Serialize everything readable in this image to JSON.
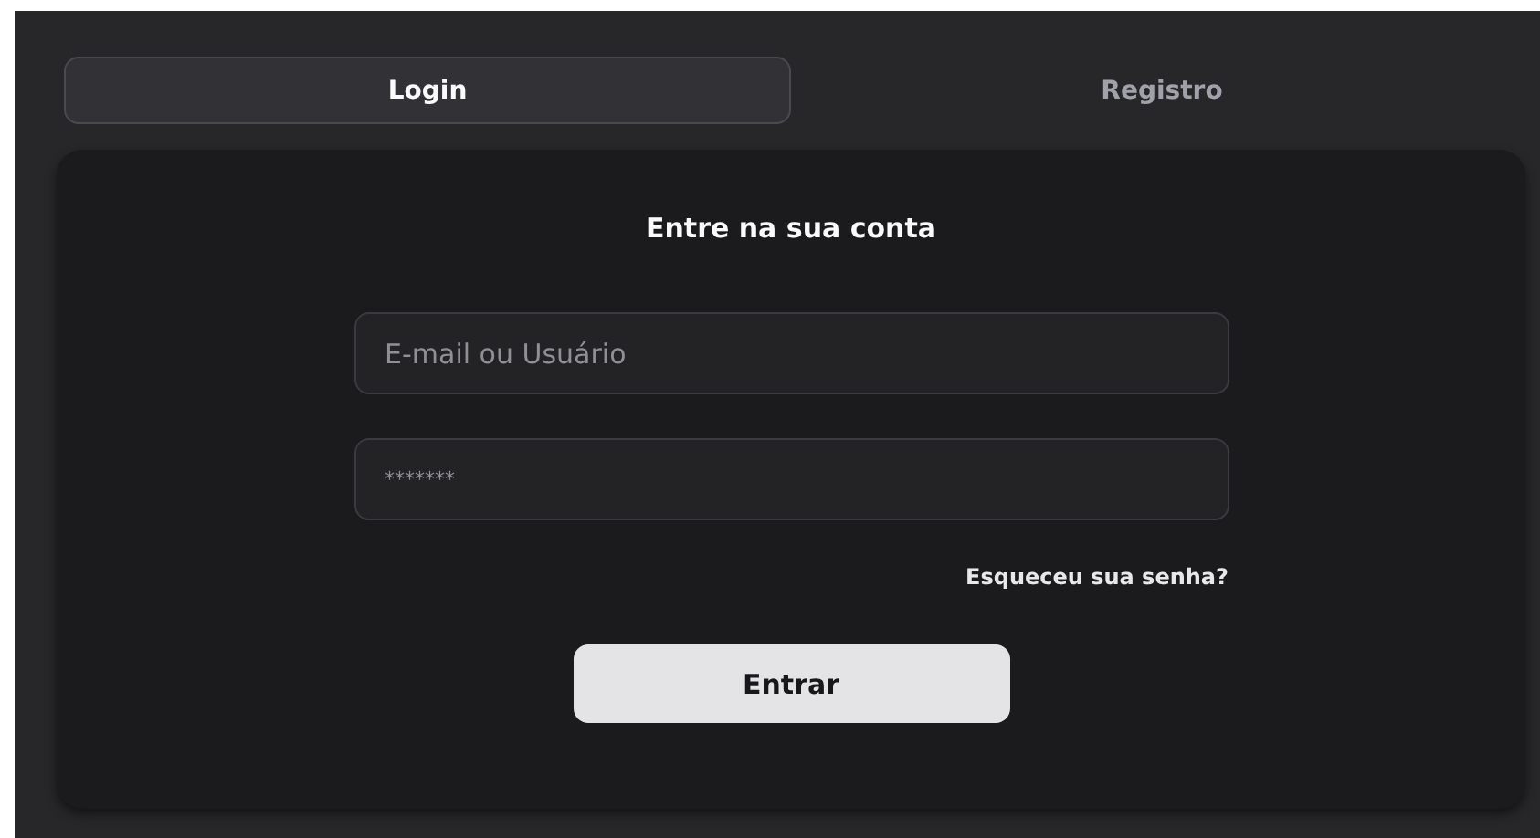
{
  "tabs": [
    {
      "label": "Login",
      "selected": true
    },
    {
      "label": "Registro",
      "selected": false
    }
  ],
  "card": {
    "title": "Entre na sua conta",
    "fields": [
      {
        "placeholder": "E-mail ou Usuário",
        "kind": "text"
      },
      {
        "placeholder": "*******",
        "kind": "password"
      }
    ],
    "forgot_link": "Esqueceu sua senha?",
    "submit_button": "Entrar"
  }
}
